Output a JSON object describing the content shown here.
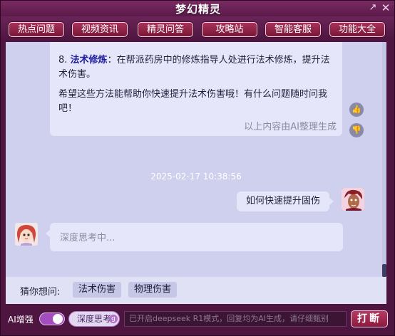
{
  "window": {
    "title": "梦幻精灵",
    "restore_icon": "restore-icon",
    "close_icon": "close-icon"
  },
  "nav": {
    "items": [
      {
        "label": "热点问题"
      },
      {
        "label": "视频资讯"
      },
      {
        "label": "精灵问答"
      },
      {
        "label": "攻略站"
      },
      {
        "label": "智能客服"
      },
      {
        "label": "功能大全"
      }
    ]
  },
  "chat": {
    "ai_message": {
      "item_prefix": "8. ",
      "item_highlight": "法术修炼",
      "item_text": "：在帮派药房中的修炼指导人处进行法术修炼，提升法术伤害。",
      "closing": "希望这些方法能帮助你快速提升法术伤害哦！有什么问题随时问我吧！",
      "note": "以上内容由AI整理生成"
    },
    "timestamp": "2025-02-17 10:38:56",
    "user_message": "如何快速提升固伤",
    "thinking_placeholder": "深度思考中..."
  },
  "suggest": {
    "label": "猜你想问:",
    "chips": [
      "法术伤害",
      "物理伤害"
    ]
  },
  "bottom": {
    "ai_label": "AI增强",
    "deep_think_label": "深度思考",
    "input_placeholder": "已开启deepseek R1模式，回复均为AI生成，请仔细甄别",
    "send_label": "打断"
  },
  "colors": {
    "accent": "#8a1b3e",
    "chat_bg": "#cfcfee",
    "bubble": "#e6e6fb"
  }
}
